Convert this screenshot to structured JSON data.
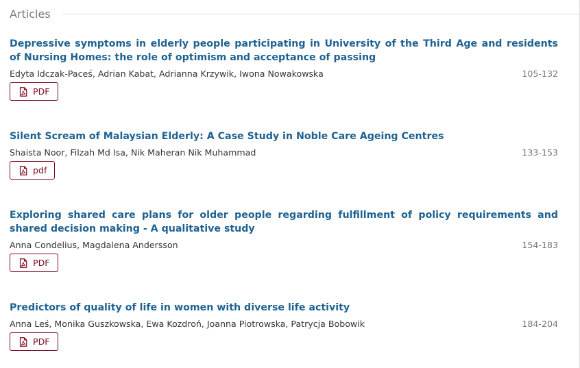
{
  "section": {
    "title": "Articles"
  },
  "articles": [
    {
      "title": "Depressive symptoms in elderly people participating in University of the Third Age and residents of Nursing Homes: the role of optimism and acceptance of passing",
      "authors": "Edyta Idczak-Paceś, Adrian Kabat, Adrianna Krzywik, Iwona Nowakowska",
      "pages": "105-132",
      "galley_label": "PDF",
      "galley_icon": "file-pdf-icon"
    },
    {
      "title": "Silent Scream of Malaysian Elderly: A Case Study in Noble Care Ageing Centres",
      "authors": "Shaista Noor, Filzah Md Isa, Nik Maheran Nik Muhammad",
      "pages": "133-153",
      "galley_label": "pdf",
      "galley_icon": "file-pdf-icon"
    },
    {
      "title": "Exploring shared care plans for older people regarding fulfillment of policy requirements and shared decision making - A qualitative study",
      "authors": "Anna Condelius, Magdalena Andersson",
      "pages": "154-183",
      "galley_label": "PDF",
      "galley_icon": "file-pdf-icon"
    },
    {
      "title": "Predictors of quality of life in women with diverse life activity",
      "authors": "Anna Leś, Monika Guszkowska, Ewa Kozdroń, Joanna Piotrowska, Patrycja Bobowik",
      "pages": "184-204",
      "galley_label": "PDF",
      "galley_icon": "file-pdf-icon"
    }
  ],
  "colors": {
    "title_link": "#1e6292",
    "galley_border": "#7c0a1e",
    "muted": "#777777",
    "text": "#333333"
  }
}
